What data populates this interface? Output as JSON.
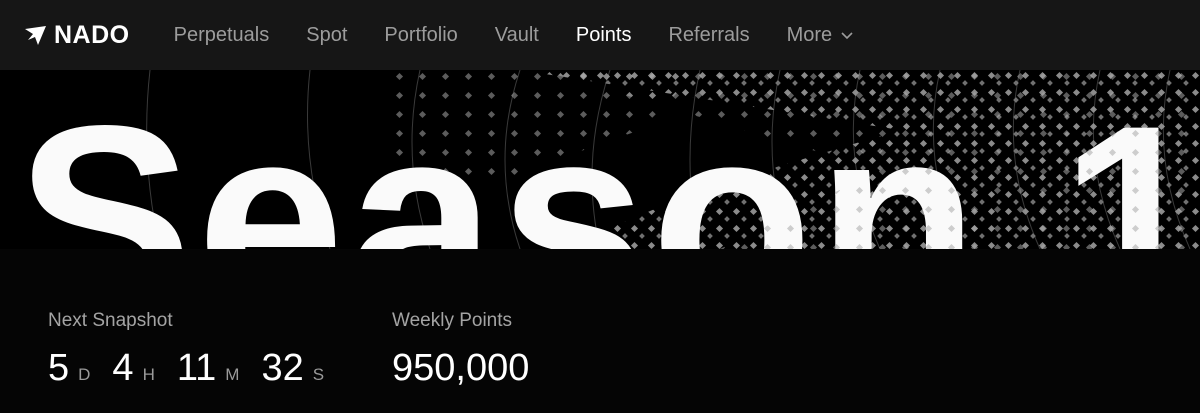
{
  "nav": {
    "logo_text": "NADO",
    "items": [
      {
        "label": "Perpetuals",
        "active": false
      },
      {
        "label": "Spot",
        "active": false
      },
      {
        "label": "Portfolio",
        "active": false
      },
      {
        "label": "Vault",
        "active": false
      },
      {
        "label": "Points",
        "active": true
      },
      {
        "label": "Referrals",
        "active": false
      },
      {
        "label": "More",
        "active": false
      }
    ]
  },
  "hero": {
    "title": "Season 1"
  },
  "snapshot": {
    "label": "Next Snapshot",
    "countdown": [
      {
        "value": "5",
        "unit": "D"
      },
      {
        "value": "4",
        "unit": "H"
      },
      {
        "value": "11",
        "unit": "M"
      },
      {
        "value": "32",
        "unit": "S"
      }
    ]
  },
  "weekly": {
    "label": "Weekly Points",
    "value": "950,000"
  },
  "colors": {
    "nav_bg": "#161616",
    "page_bg": "#050505",
    "muted_text": "#9c9c9c",
    "dot_pattern": "#9a9a9a"
  }
}
